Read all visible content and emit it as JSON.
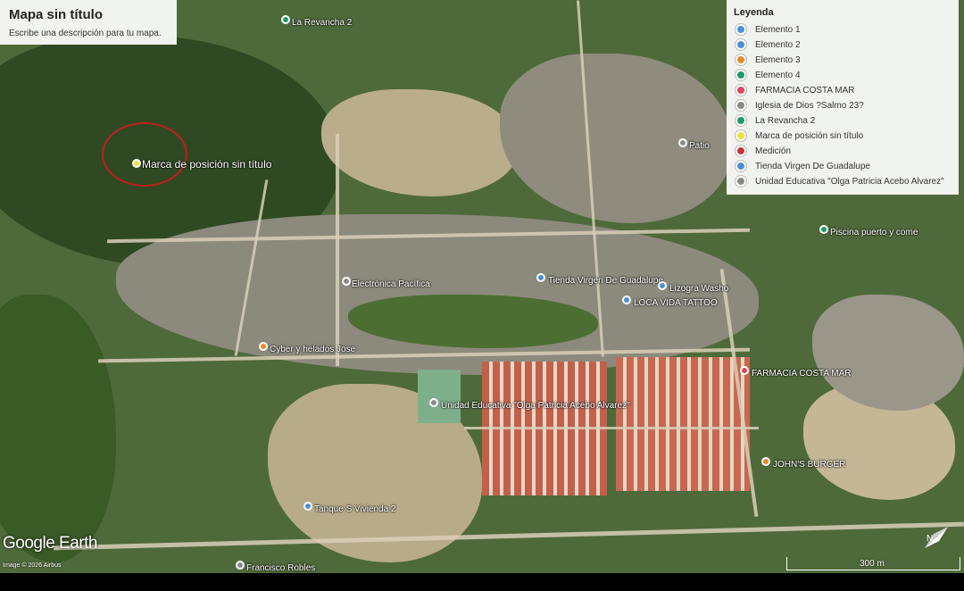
{
  "map": {
    "title": "Mapa sin título",
    "description": "Escribe una descripción para tu mapa.",
    "legend_title": "Leyenda",
    "legend": [
      {
        "label": "Elemento 1",
        "color": "#4a90d9"
      },
      {
        "label": "Elemento 2",
        "color": "#4a90d9"
      },
      {
        "label": "Elemento 3",
        "color": "#e8892b"
      },
      {
        "label": "Elemento 4",
        "color": "#1a9e63"
      },
      {
        "label": "FARMACIA COSTA MAR",
        "color": "#e0455a"
      },
      {
        "label": "Iglesia de Dios ?Salmo 23?",
        "color": "#8a8a8a"
      },
      {
        "label": "La Revancha 2",
        "color": "#1a9e63"
      },
      {
        "label": "Marca de posición sin título",
        "color": "#f1e03a"
      },
      {
        "label": "Medición",
        "color": "#cc3333"
      },
      {
        "label": "Tienda Virgen De Guadalupe",
        "color": "#4a90d9"
      },
      {
        "label": "Unidad Educativa \"Olga Patricia Acebo Alvarez\"",
        "color": "#8a8a8a"
      }
    ],
    "places": {
      "marca": "Marca de posición sin título",
      "tienda": "Tienda Virgen De Guadalupe",
      "leche": "Electrónica Pacífica",
      "glorias": "Lizogra Washo",
      "loca": "LOCA VIDA TATTOO",
      "farmacia": "FARMACIA COSTA MAR",
      "unidad": "Unidad Educativa \"Olga Patricia Acebo Alvarez\"",
      "cyber": "Cyber y helados Jose",
      "johns": "JOHN'S BURGER",
      "tanque": "Tanque S Vivienda 2",
      "francisco": "Francisco Robles",
      "piscina": "Piscina puerto y come",
      "revancha": "La Revancha 2",
      "patio": "Patio"
    },
    "brand": "Google Earth",
    "attribution": "Image © 2026 Airbus",
    "scale": "300 m"
  }
}
